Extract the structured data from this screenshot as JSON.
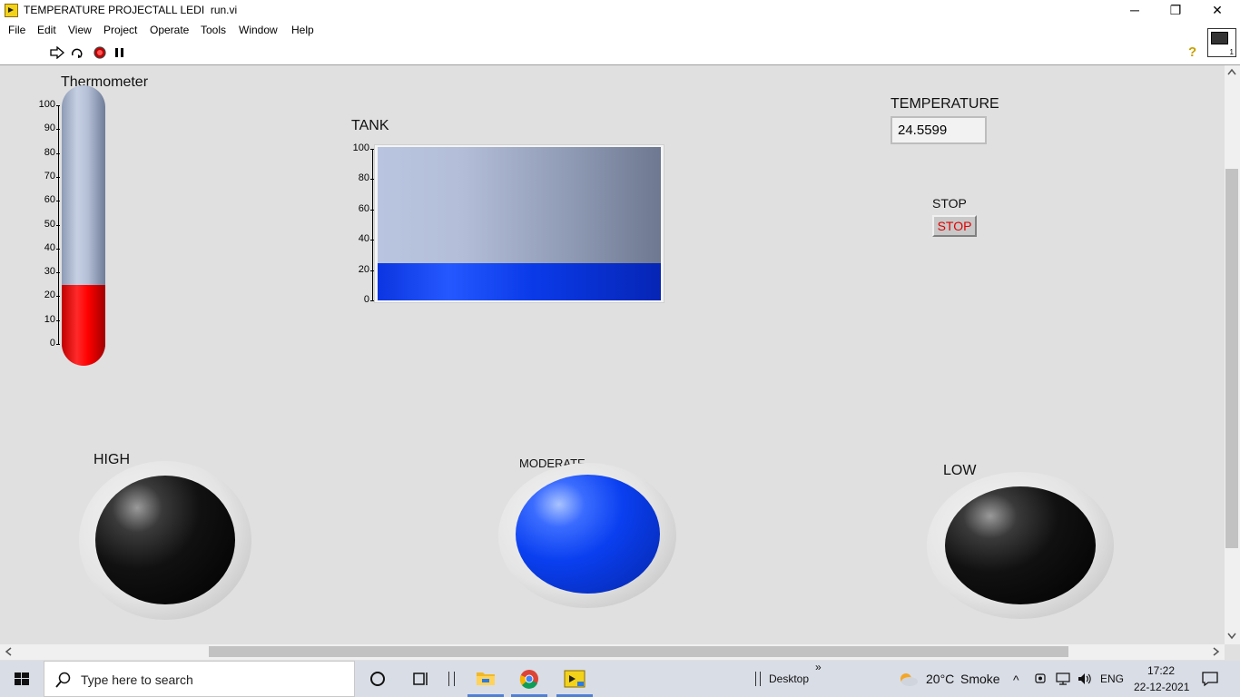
{
  "window": {
    "title": "TEMPERATURE PROJECTALL LEDI  run.vi",
    "minimize_glyph": "─",
    "maximize_glyph": "❐",
    "close_glyph": "✕"
  },
  "menu": [
    "File",
    "Edit",
    "View",
    "Project",
    "Operate",
    "Tools",
    "Window",
    "Help"
  ],
  "toolbar": {
    "icons": [
      "run-arrow-icon",
      "run-continuously-icon",
      "abort-execution-icon",
      "pause-icon"
    ],
    "help_glyph": "?",
    "vi_icon_number": "1"
  },
  "thermometer": {
    "label": "Thermometer",
    "scale": [
      "100",
      "90",
      "80",
      "70",
      "60",
      "50",
      "40",
      "30",
      "20",
      "10",
      "0"
    ],
    "value": 24.5599,
    "min": 0,
    "max": 100,
    "fill_color": "#ff0000"
  },
  "tank": {
    "label": "TANK",
    "scale": [
      "100",
      "80",
      "60",
      "40",
      "20",
      "0"
    ],
    "value": 24.5599,
    "min": 0,
    "max": 100,
    "fill_color": "#1a4cff"
  },
  "temperature": {
    "label": "TEMPERATURE",
    "value": "24.5599"
  },
  "stop": {
    "label": "STOP",
    "button_text": "STOP",
    "text_color": "#e00000"
  },
  "leds": {
    "high": {
      "label": "HIGH",
      "state": "off"
    },
    "moderate": {
      "label": "MODERATE",
      "state": "on",
      "color": "#1a4cff"
    },
    "low": {
      "label": "LOW",
      "state": "off"
    }
  },
  "taskbar": {
    "search_placeholder": "Type here to search",
    "desktop_label": "Desktop",
    "weather_temp": "20°C",
    "weather_desc": "Smoke",
    "language": "ENG",
    "time": "17:22",
    "date": "22-12-2021",
    "chevron_glyph": "»",
    "up_glyph": "^"
  }
}
